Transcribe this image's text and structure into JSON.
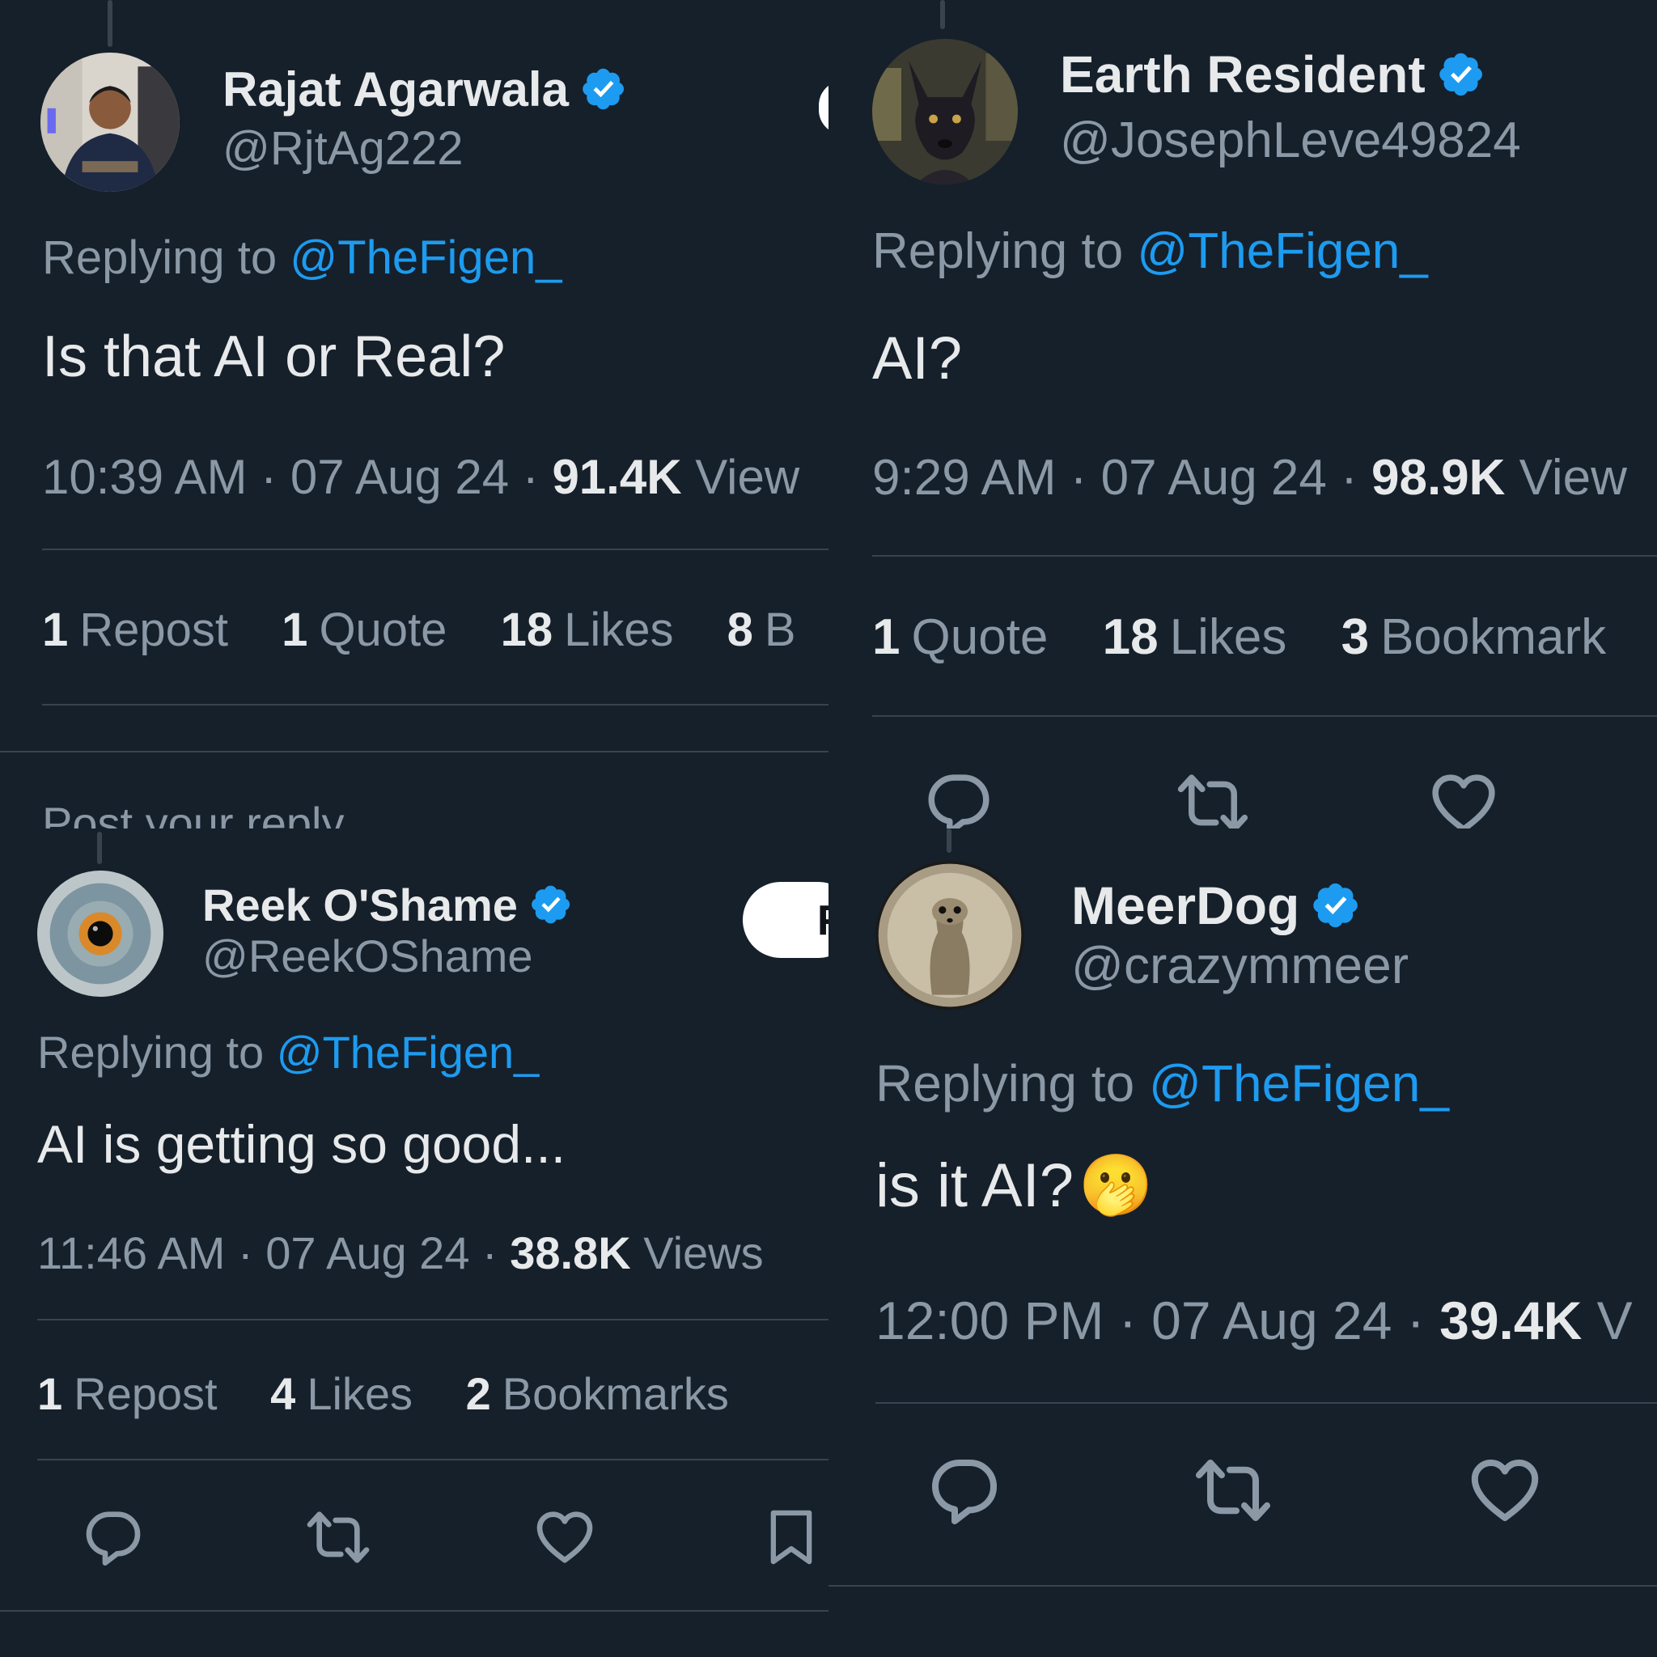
{
  "colors": {
    "background": "#15202b",
    "text": "#e7e9ea",
    "secondary": "#8b98a5",
    "accent": "#1d9bf0",
    "divider": "#38444d"
  },
  "tweets": [
    {
      "name": "Rajat Agarwala",
      "handle": "@RjtAg222",
      "replying_prefix": "Replying to",
      "replying_to": "@TheFigen_",
      "text": "Is that AI or Real?",
      "time": "10:39 AM",
      "date": "07 Aug 24",
      "views": "91.4K",
      "views_label": "View",
      "stats": [
        {
          "count": "1",
          "label": "Repost"
        },
        {
          "count": "1",
          "label": "Quote"
        },
        {
          "count": "18",
          "label": "Likes"
        },
        {
          "count": "8",
          "label": "B"
        }
      ],
      "footer_fragment": "Post your reply"
    },
    {
      "name": "Earth Resident",
      "handle": "@JosephLeve49824",
      "replying_prefix": "Replying to",
      "replying_to": "@TheFigen_",
      "text": "AI?",
      "time": "9:29 AM",
      "date": "07 Aug 24",
      "views": "98.9K",
      "views_label": "View",
      "stats": [
        {
          "count": "1",
          "label": "Quote"
        },
        {
          "count": "18",
          "label": "Likes"
        },
        {
          "count": "3",
          "label": "Bookmark"
        }
      ],
      "actions": [
        "reply-icon",
        "retweet-icon",
        "like-icon"
      ]
    },
    {
      "name": "Reek O'Shame",
      "handle": "@ReekOShame",
      "replying_prefix": "Replying to",
      "replying_to": "@TheFigen_",
      "text": "AI is getting so good...",
      "time": "11:46 AM",
      "date": "07 Aug 24",
      "views": "38.8K",
      "views_label": "Views",
      "stats": [
        {
          "count": "1",
          "label": "Repost"
        },
        {
          "count": "4",
          "label": "Likes"
        },
        {
          "count": "2",
          "label": "Bookmarks"
        }
      ],
      "follow_fragment": "F",
      "actions": [
        "reply-icon",
        "retweet-icon",
        "like-icon",
        "bookmark-icon"
      ]
    },
    {
      "name": "MeerDog",
      "handle": "@crazymmeer",
      "replying_prefix": "Replying to",
      "replying_to": "@TheFigen_",
      "text": "is it AI?",
      "emoji": "🫢",
      "time": "12:00 PM",
      "date": "07 Aug 24",
      "views": "39.4K",
      "views_label": "V",
      "actions": [
        "reply-icon",
        "retweet-icon",
        "like-icon"
      ]
    }
  ]
}
